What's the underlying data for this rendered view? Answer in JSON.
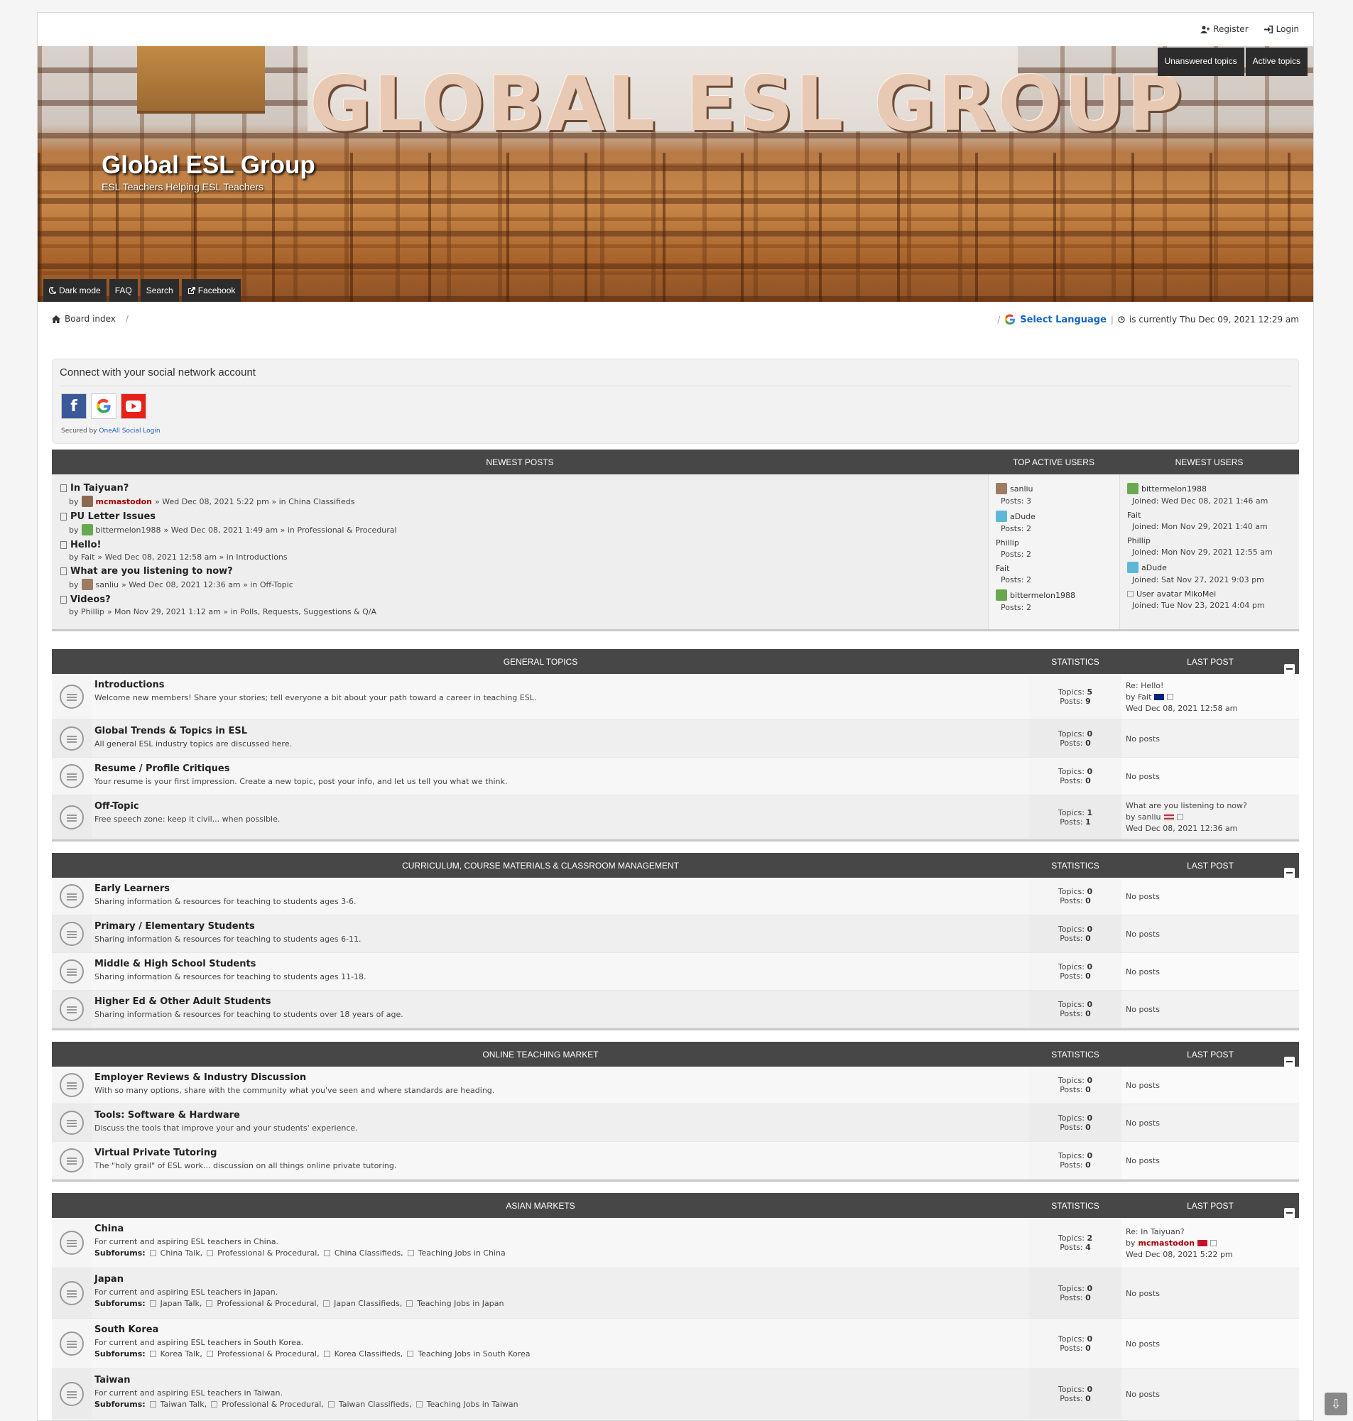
{
  "top": {
    "register": "Register",
    "login": "Login"
  },
  "banner": {
    "big_title": "GLOBAL ESL GROUP",
    "site_title": "Global ESL Group",
    "site_desc": "ESL Teachers Helping ESL Teachers",
    "unanswered": "Unanswered topics",
    "active": "Active topics",
    "nav": [
      "Dark mode",
      "FAQ",
      "Search",
      "Facebook"
    ]
  },
  "crumbs": {
    "board_index": "Board index"
  },
  "info": {
    "select_language": "Select Language",
    "time": "is currently Thu Dec 09, 2021 12:29 am"
  },
  "social": {
    "title": "Connect with your social network account",
    "secured": "Secured by ",
    "provider": "OneAll Social Login"
  },
  "newest": {
    "headers": {
      "posts": "NEWEST POSTS",
      "active": "TOP ACTIVE USERS",
      "users": "NEWEST USERS"
    },
    "posts": [
      {
        "title": "In Taiyuan?",
        "by": "by",
        "user": "mcmastodon",
        "meta": "» Wed Dec 08, 2021 5:22 pm » in China Classifieds"
      },
      {
        "title": "PU Letter Issues",
        "by": "by",
        "user": "bittermelon1988",
        "meta": "» Wed Dec 08, 2021 1:49 am » in Professional & Procedural"
      },
      {
        "title": "Hello!",
        "by": "by Fait",
        "user": "",
        "meta": "» Wed Dec 08, 2021 12:58 am » in Introductions"
      },
      {
        "title": "What are you listening to now?",
        "by": "by",
        "user": "sanliu",
        "meta": "» Wed Dec 08, 2021 12:36 am » in Off-Topic"
      },
      {
        "title": "Videos?",
        "by": "by Phillip",
        "user": "",
        "meta": "» Mon Nov 29, 2021 1:12 am » in Polls, Requests, Suggestions & Q/A"
      }
    ],
    "active_users": [
      {
        "name": "sanliu",
        "posts": "Posts: 3"
      },
      {
        "name": "aDude",
        "posts": "Posts: 2"
      },
      {
        "name": "Phillip",
        "posts": "Posts: 2"
      },
      {
        "name": "Fait",
        "posts": "Posts: 2"
      },
      {
        "name": "bittermelon1988",
        "posts": "Posts: 2"
      }
    ],
    "new_users": [
      {
        "name": "bittermelon1988",
        "joined": "Joined: Wed Dec 08, 2021 1:46 am"
      },
      {
        "name": "Fait",
        "joined": "Joined: Mon Nov 29, 2021 1:40 am"
      },
      {
        "name": "Phillip",
        "joined": "Joined: Mon Nov 29, 2021 12:55 am"
      },
      {
        "name": "aDude",
        "joined": "Joined: Sat Nov 27, 2021 9:03 pm"
      },
      {
        "name": "User avatar MikoMei",
        "joined": "Joined: Tue Nov 23, 2021 4:04 pm"
      }
    ]
  },
  "labels": {
    "statistics": "STATISTICS",
    "last_post": "LAST POST",
    "topics": "Topics:",
    "posts": "Posts:",
    "no_posts": "No posts",
    "subforums": "Subforums:"
  },
  "sections": [
    {
      "title": "GENERAL TOPICS",
      "forums": [
        {
          "name": "Introductions",
          "desc": "Welcome new members! Share your stories; tell everyone a bit about your path toward a career in teaching ESL.",
          "topics": "5",
          "posts": "9",
          "last": {
            "title": "Re: Hello!",
            "by": "by Fait",
            "date": "Wed Dec 08, 2021 12:58 am"
          }
        },
        {
          "name": "Global Trends & Topics in ESL",
          "desc": "All general ESL industry topics are discussed here.",
          "topics": "0",
          "posts": "0"
        },
        {
          "name": "Resume / Profile Critiques",
          "desc": "Your resume is your first impression. Create a new topic, post your info, and let us tell you what we think.",
          "topics": "0",
          "posts": "0"
        },
        {
          "name": "Off-Topic",
          "desc": "Free speech zone: keep it civil... when possible.",
          "topics": "1",
          "posts": "1",
          "last": {
            "title": "What are you listening to now?",
            "by": "by sanliu",
            "date": "Wed Dec 08, 2021 12:36 am"
          }
        }
      ]
    },
    {
      "title": "CURRICULUM, COURSE MATERIALS & CLASSROOM MANAGEMENT",
      "forums": [
        {
          "name": "Early Learners",
          "desc": "Sharing information & resources for teaching to students ages 3-6.",
          "topics": "0",
          "posts": "0"
        },
        {
          "name": "Primary / Elementary Students",
          "desc": "Sharing information & resources for teaching to students ages 6-11.",
          "topics": "0",
          "posts": "0"
        },
        {
          "name": "Middle & High School Students",
          "desc": "Sharing information & resources for teaching to students ages 11-18.",
          "topics": "0",
          "posts": "0"
        },
        {
          "name": "Higher Ed & Other Adult Students",
          "desc": "Sharing information & resources for teaching to students over 18 years of age.",
          "topics": "0",
          "posts": "0"
        }
      ]
    },
    {
      "title": "ONLINE TEACHING MARKET",
      "forums": [
        {
          "name": "Employer Reviews & Industry Discussion",
          "desc": "With so many options, share with the community what you've seen and where standards are heading.",
          "topics": "0",
          "posts": "0"
        },
        {
          "name": "Tools: Software & Hardware",
          "desc": "Discuss the tools that improve your and your students' experience.",
          "topics": "0",
          "posts": "0"
        },
        {
          "name": "Virtual Private Tutoring",
          "desc": "The \"holy grail\" of ESL work... discussion on all things online private tutoring.",
          "topics": "0",
          "posts": "0"
        }
      ]
    },
    {
      "title": "ASIAN MARKETS",
      "forums": [
        {
          "name": "China",
          "desc": "For current and aspiring ESL teachers in China.",
          "subforums": [
            "China Talk,",
            "Professional & Procedural,",
            "China Classifieds,",
            "Teaching Jobs in China"
          ],
          "topics": "2",
          "posts": "4",
          "last": {
            "title": "Re: In Taiyuan?",
            "by": "by",
            "user": "mcmastodon",
            "date": "Wed Dec 08, 2021 5:22 pm"
          }
        },
        {
          "name": "Japan",
          "desc": "For current and aspiring ESL teachers in Japan.",
          "subforums": [
            "Japan Talk,",
            "Professional & Procedural,",
            "Japan Classifieds,",
            "Teaching Jobs in Japan"
          ],
          "topics": "0",
          "posts": "0"
        },
        {
          "name": "South Korea",
          "desc": "For current and aspiring ESL teachers in South Korea.",
          "subforums": [
            "Korea Talk,",
            "Professional & Procedural,",
            "Korea Classifieds,",
            "Teaching Jobs in South Korea"
          ],
          "topics": "0",
          "posts": "0"
        },
        {
          "name": "Taiwan",
          "desc": "For current and aspiring ESL teachers in Taiwan.",
          "subforums": [
            "Taiwan Talk,",
            "Professional & Procedural,",
            "Taiwan Classifieds,",
            "Teaching Jobs in Taiwan"
          ],
          "topics": "0",
          "posts": "0"
        }
      ]
    }
  ]
}
